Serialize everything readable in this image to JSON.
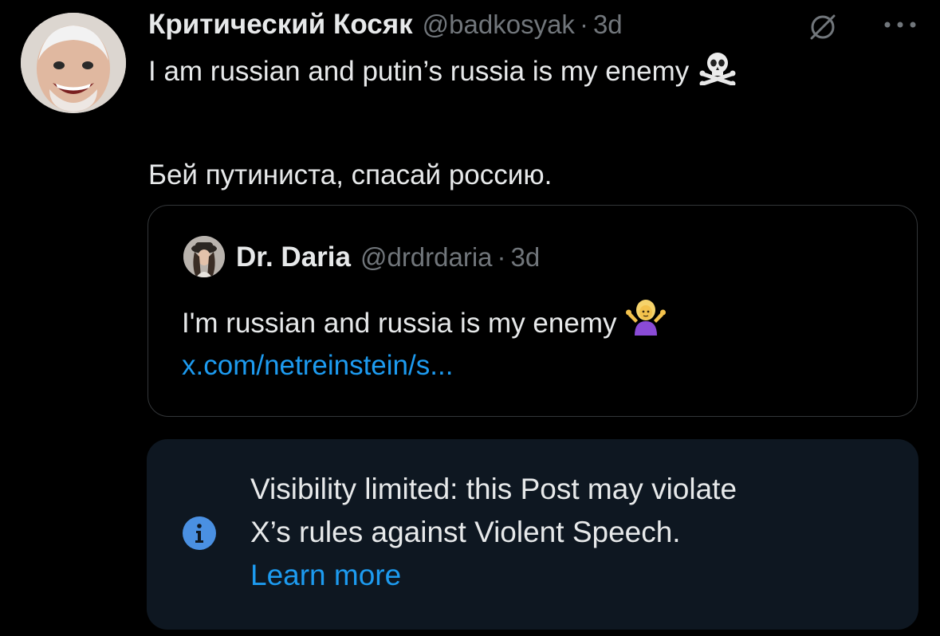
{
  "tweet": {
    "author_name": "Критический Косяк",
    "handle": "@badkosyak",
    "separator": "·",
    "time": "3d",
    "text_line1": "I am russian and putin’s russia is my enemy",
    "text_line1_emoji": "☠️",
    "text_line2": "Бей путиниста, спасай россию."
  },
  "icons": {
    "grok": "grok-slash-icon",
    "more": "more-dots-icon",
    "info": "info-icon"
  },
  "quote": {
    "author_name": "Dr. Daria",
    "handle": "@drdrdaria",
    "separator": "·",
    "time": "3d",
    "text": "I'm russian and russia is my enemy",
    "text_emoji": "🤷‍♀️",
    "link": "x.com/netreinstein/s..."
  },
  "notice": {
    "line1": "Visibility limited: this Post may violate",
    "line2": "X’s rules against Violent Speech.",
    "learn_more": "Learn more"
  },
  "colors": {
    "background": "#000000",
    "text": "#e7e9ea",
    "secondary": "#71767b",
    "link": "#1d9bf0",
    "notice_bg": "#0e1721",
    "border": "#333639"
  }
}
